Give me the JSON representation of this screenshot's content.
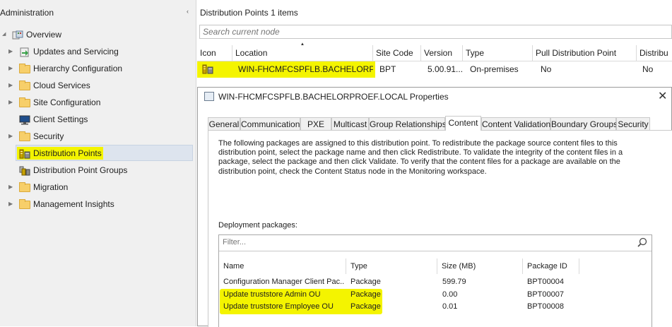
{
  "nav": {
    "title": "Administration",
    "collapse_glyph": "‹",
    "items": [
      {
        "label": "Overview",
        "icon": "overview-icon",
        "arrow": "◢"
      },
      {
        "label": "Updates and Servicing",
        "icon": "updates-icon",
        "arrow": "▶"
      },
      {
        "label": "Hierarchy Configuration",
        "icon": "folder-icon",
        "arrow": "▶"
      },
      {
        "label": "Cloud Services",
        "icon": "folder-icon",
        "arrow": "▶"
      },
      {
        "label": "Site Configuration",
        "icon": "folder-icon",
        "arrow": "▶"
      },
      {
        "label": "Client Settings",
        "icon": "monitor-icon",
        "arrow": ""
      },
      {
        "label": "Security",
        "icon": "folder-icon",
        "arrow": "▶"
      },
      {
        "label": "Distribution Points",
        "icon": "distribution-point-icon",
        "arrow": "",
        "selected": true
      },
      {
        "label": "Distribution Point Groups",
        "icon": "distribution-point-group-icon",
        "arrow": ""
      },
      {
        "label": "Migration",
        "icon": "folder-icon",
        "arrow": "▶"
      },
      {
        "label": "Management Insights",
        "icon": "folder-icon",
        "arrow": "▶"
      }
    ]
  },
  "list": {
    "title": "Distribution Points",
    "count": "1 items",
    "search_placeholder": "Search current node",
    "sort_glyph": "▲",
    "columns": [
      "Icon",
      "Location",
      "Site Code",
      "Version",
      "Type",
      "Pull Distribution Point",
      "Distribu"
    ],
    "row": {
      "location": "WIN-FHCMFCSPFLB.BACHELORP...",
      "site_code": "BPT",
      "version": "5.00.91...",
      "type": "On-premises",
      "pull": "No",
      "distrib": "No"
    }
  },
  "dialog": {
    "title": "WIN-FHCMFCSPFLB.BACHELORPROEF.LOCAL Properties",
    "close_glyph": "✕",
    "tabs": [
      "General",
      "Communication",
      "PXE",
      "Multicast",
      "Group Relationships",
      "Content",
      "Content Validation",
      "Boundary Groups",
      "Security"
    ],
    "active_tab": "Content",
    "description": "The following packages are assigned to this distribution point. To redistribute the package source content files to this distribution point, select the package name and then click Redistribute. To validate the integrity of the content files in a package, select the package and then click Validate. To verify that the content files for a package are available on the distribution point, check the Content Status node in the Monitoring workspace.",
    "deployment_label": "Deployment packages:",
    "filter_placeholder": "Filter...",
    "package_columns": [
      "Name",
      "Type",
      "Size (MB)",
      "Package ID"
    ],
    "packages": [
      {
        "name": "Configuration Manager Client Pac...",
        "type": "Package",
        "size": "599.79",
        "id": "BPT00004",
        "highlighted": false
      },
      {
        "name": "Update truststore Admin OU",
        "type": "Package",
        "size": "0.00",
        "id": "BPT00007",
        "highlighted": true
      },
      {
        "name": "Update truststore Employee OU",
        "type": "Package",
        "size": "0.01",
        "id": "BPT00008",
        "highlighted": true
      }
    ]
  },
  "colors": {
    "highlight": "#f4f400",
    "selection": "#dde4ee",
    "folder": "#f7cf6a",
    "panel_bg": "#f0f0f0"
  }
}
